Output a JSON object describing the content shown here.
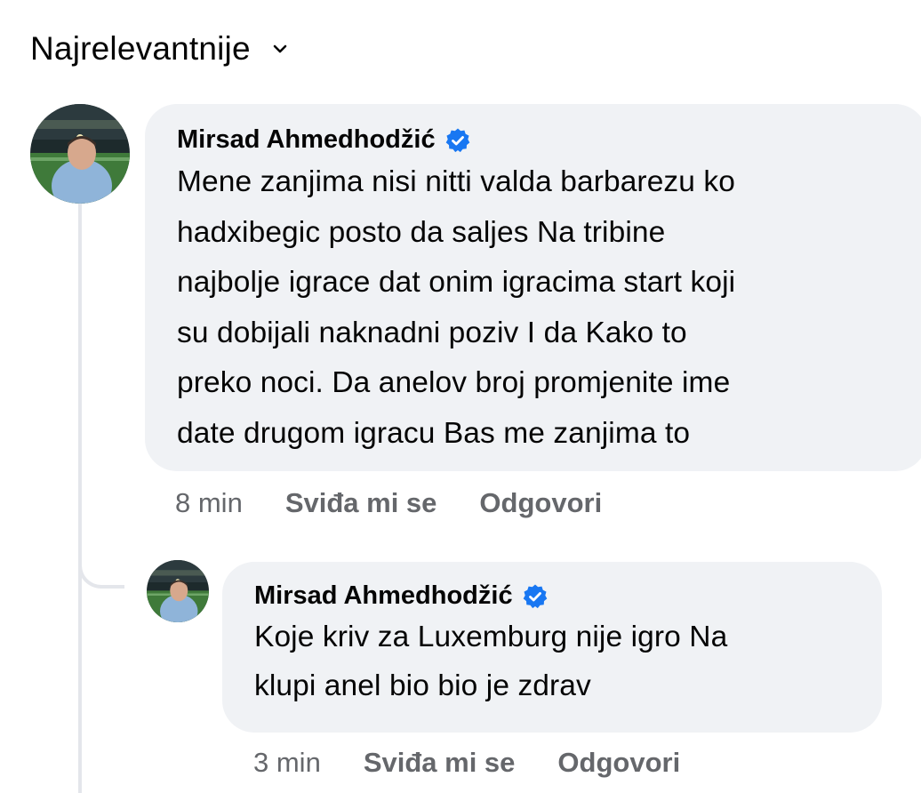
{
  "sort": {
    "label": "Najrelevantnije",
    "icon": "chevron-down-icon"
  },
  "comments": [
    {
      "author": "Mirsad Ahmedhodžić",
      "verified": true,
      "text": "Mene zanjima nisi nitti valda  barbarezu ko\nhadxibegic posto da saljes Na tribine\nnajbolje igrace  dat onim igracima start koji\nsu dobijali naknadni poziv  I da Kako to\npreko noci. Da anelov broj promjenite  ime\ndate drugom igracu  Bas me zanjima to",
      "time": "8 min",
      "like_label": "Sviđa mi se",
      "reply_label": "Odgovori"
    }
  ],
  "reply": {
    "author": "Mirsad Ahmedhodžić",
    "verified": true,
    "text": "Koje kriv za Luxemburg  nije igro Na\nklupi anel bio  bio je zdrav",
    "time": "3 min",
    "like_label": "Sviđa mi se",
    "reply_label": "Odgovori"
  },
  "colors": {
    "bubble": "#f0f2f5",
    "secondary_text": "#65676b",
    "verified_badge": "#1877f2",
    "thread_line": "#e4e6eb"
  }
}
